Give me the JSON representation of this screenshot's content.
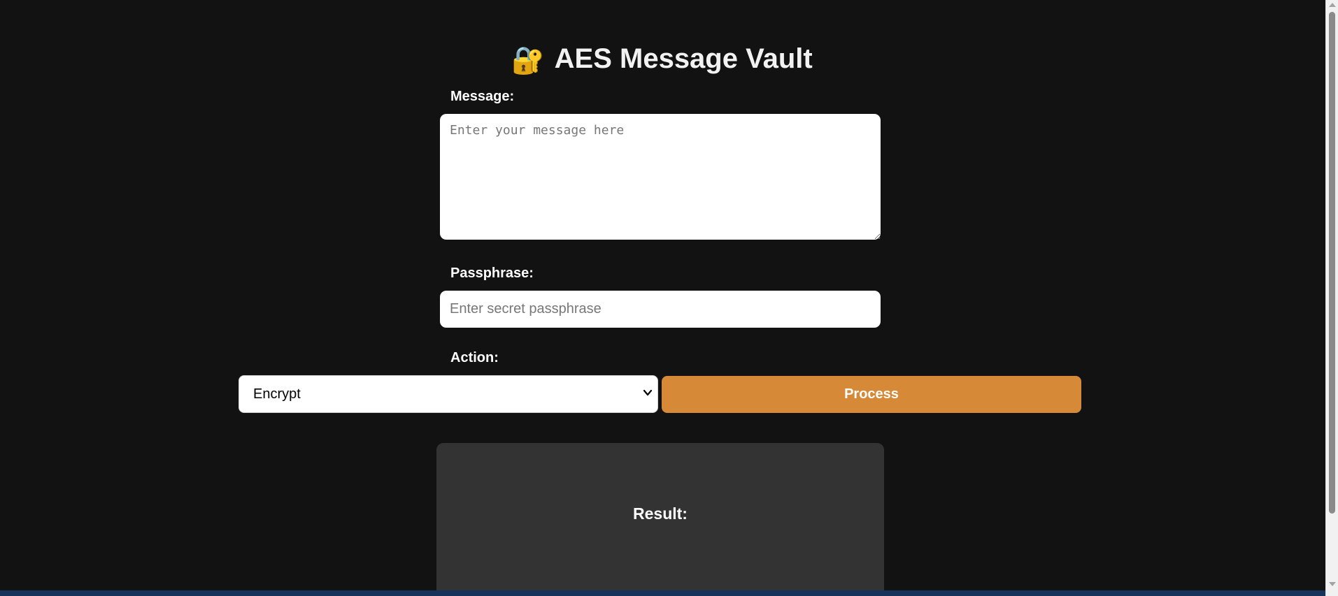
{
  "app": {
    "title_emoji": "🔐",
    "title": "AES Message Vault"
  },
  "form": {
    "message_label": "Message:",
    "message_placeholder": "Enter your message here",
    "message_value": "",
    "passphrase_label": "Passphrase:",
    "passphrase_placeholder": "Enter secret passphrase",
    "passphrase_value": "",
    "action_label": "Action:",
    "action_selected": "Encrypt",
    "process_label": "Process"
  },
  "result": {
    "title": "Result:"
  },
  "icons": {
    "title_icon": "locked-with-key-icon",
    "select_icon": "chevron-down-icon"
  },
  "colors": {
    "background": "#121212",
    "accent": "#d68a38",
    "result_panel": "#333333"
  }
}
